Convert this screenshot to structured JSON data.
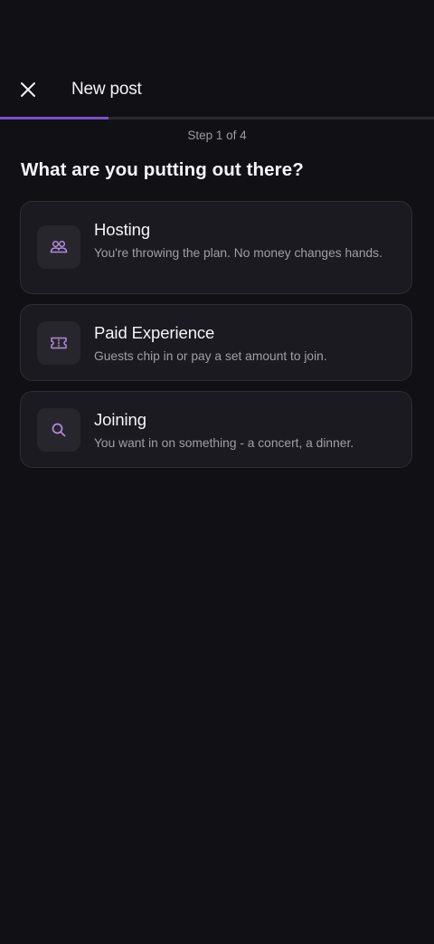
{
  "header": {
    "title": "New post"
  },
  "progress": {
    "step_label": "Step 1 of 4",
    "current_step": 1,
    "total_steps": 4,
    "fraction": 0.25
  },
  "question": "What are you putting out there?",
  "options": [
    {
      "title": "Hosting",
      "description": "You're throwing the plan. No money changes hands.",
      "icon": "people-icon"
    },
    {
      "title": "Paid Experience",
      "description": "Guests chip in or pay a set amount to join.",
      "icon": "ticket-icon"
    },
    {
      "title": "Joining",
      "description": "You want in on something - a concert, a dinner.",
      "icon": "search-icon"
    }
  ],
  "colors": {
    "background": "#111014",
    "accent": "#7b4fd0",
    "icon_tint": "#b58ad9",
    "card": "#1b1a20"
  }
}
